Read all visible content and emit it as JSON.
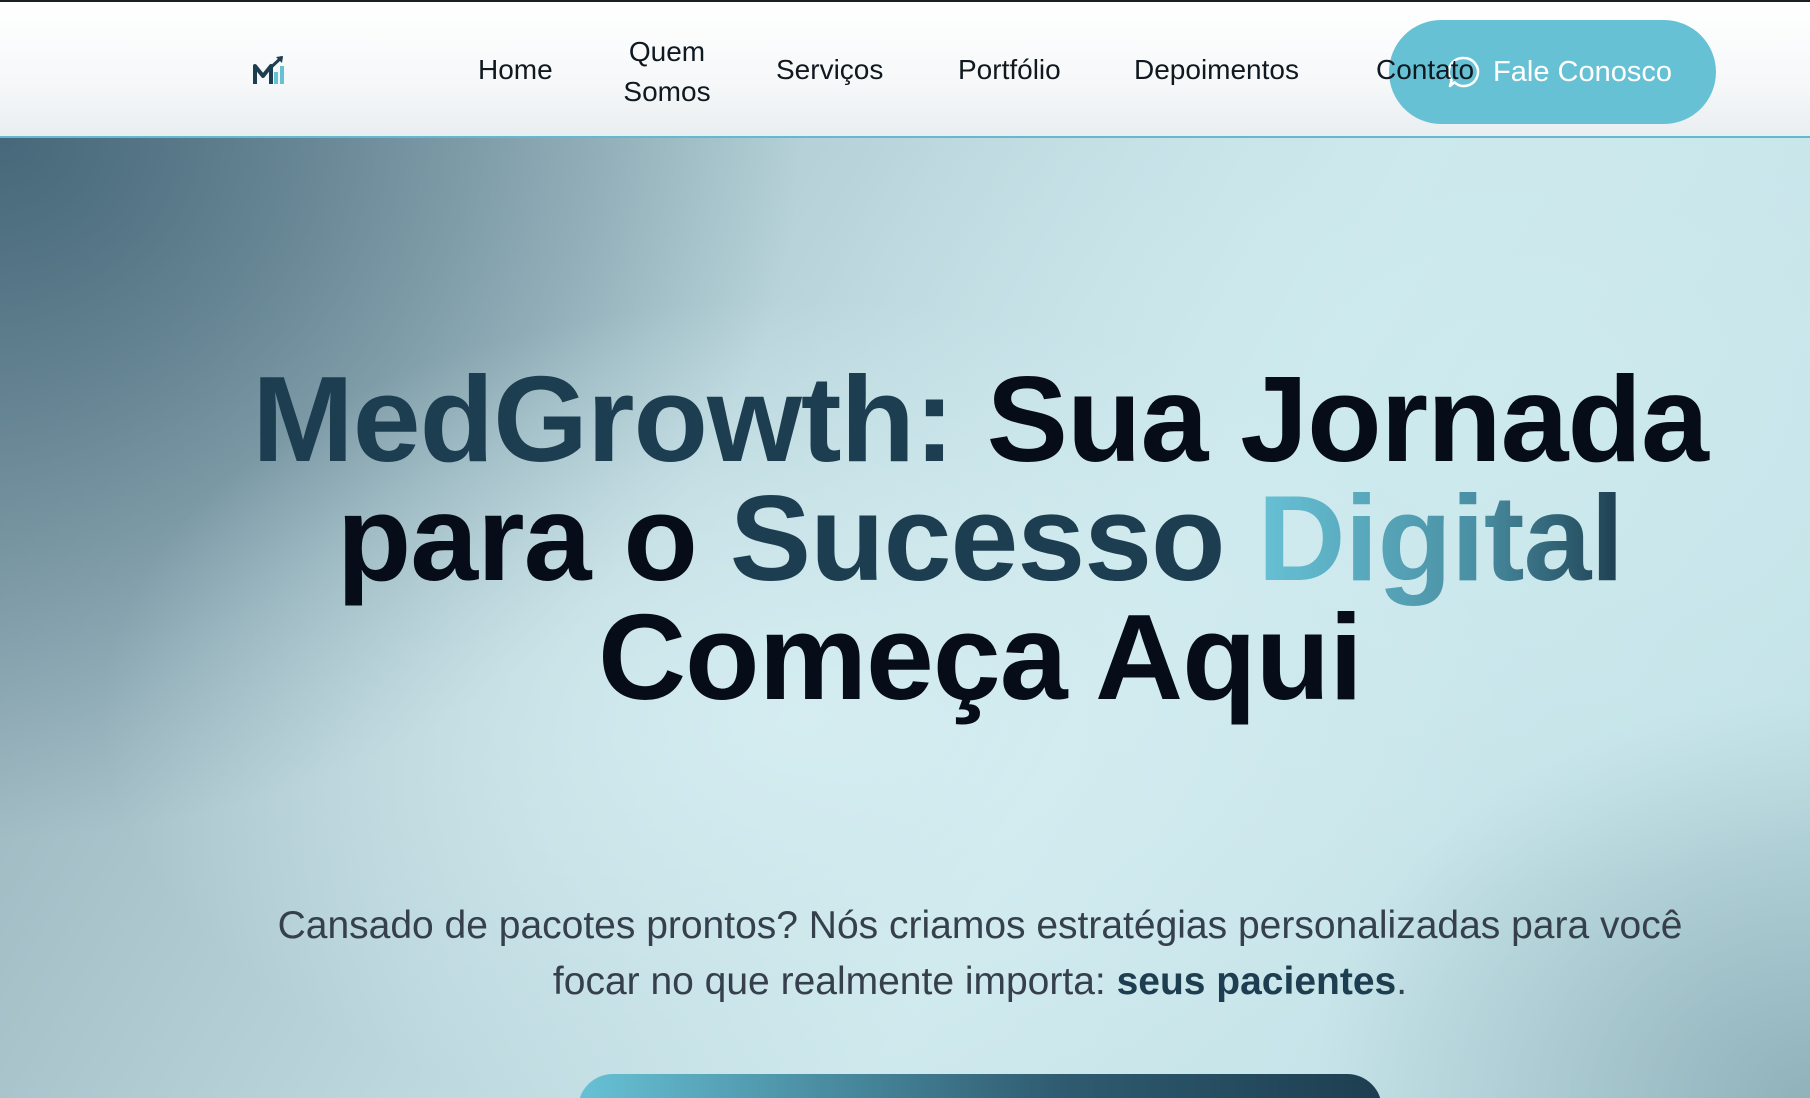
{
  "brand": {
    "logo_icon": "medgrowth-chart-logo-icon"
  },
  "nav": {
    "home": "Home",
    "quem_somos": "Quem Somos",
    "servicos": "Serviços",
    "portfolio": "Portfólio",
    "depoimentos": "Depoimentos",
    "contato": "Contato"
  },
  "cta_top": {
    "label": "Fale Conosco",
    "icon": "whatsapp-icon"
  },
  "hero": {
    "headline_brand": "MedGrowth:",
    "headline_part1": " Sua Jornada para o ",
    "headline_sucesso": "Sucesso ",
    "headline_digital": "Digital",
    "headline_part2": " Começa Aqui",
    "subtitle_text": "Cansado de pacotes prontos? Nós criamos estratégias personalizadas para você focar no que realmente importa: ",
    "subtitle_strong": "seus pacientes",
    "subtitle_end": "."
  },
  "colors": {
    "accent": "#67c1d5",
    "brand_dark": "#1d3e50",
    "text_dark": "#060c18"
  }
}
